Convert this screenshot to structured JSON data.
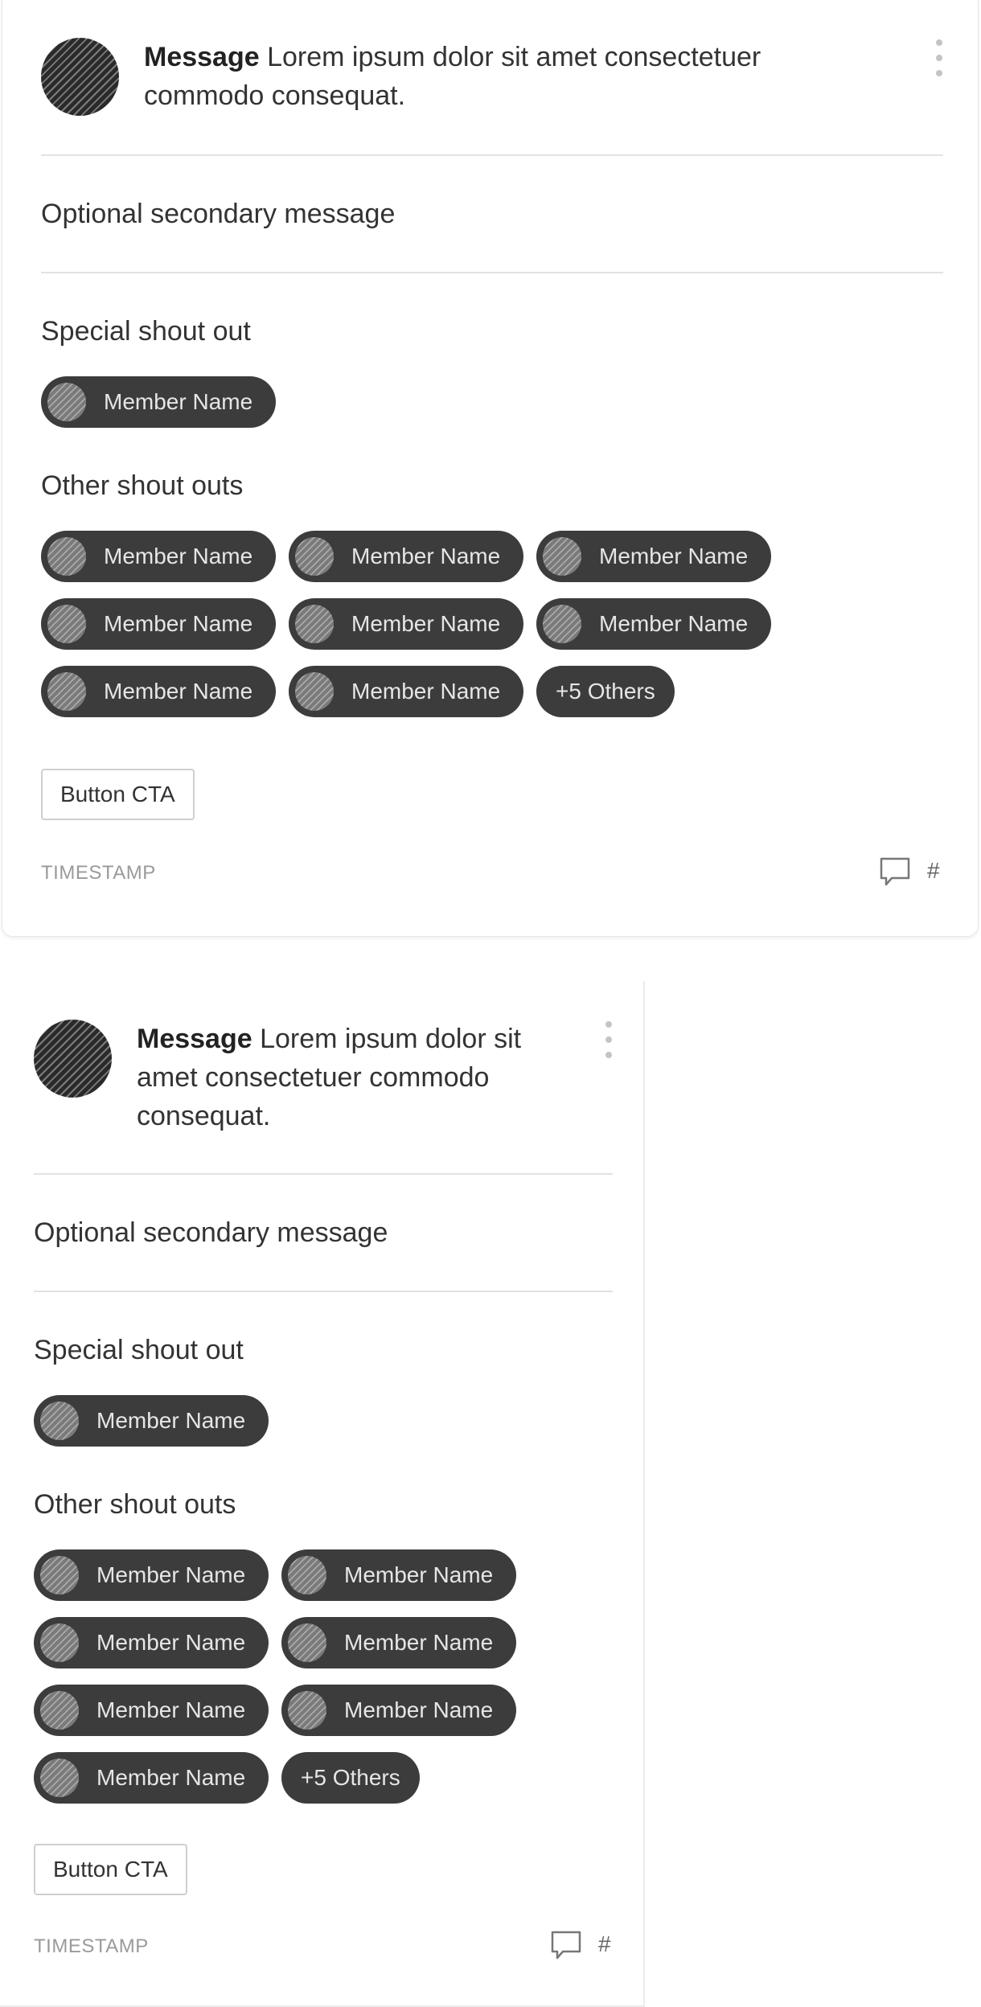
{
  "cards": [
    {
      "message_bold": "Message",
      "message_text": "Lorem ipsum dolor sit amet consectetuer commodo consequat.",
      "secondary": "Optional secondary message",
      "special_label": "Special shout out",
      "special_member": "Member Name",
      "other_label": "Other shout outs",
      "others": [
        "Member Name",
        "Member Name",
        "Member Name",
        "Member Name",
        "Member Name",
        "Member Name",
        "Member Name",
        "Member Name"
      ],
      "others_more": "+5 Others",
      "cta": "Button CTA",
      "timestamp": "TIMESTAMP",
      "hash": "#"
    },
    {
      "message_bold": "Message",
      "message_text": "Lorem ipsum dolor sit amet consectetuer commodo consequat.",
      "secondary": "Optional secondary message",
      "special_label": "Special shout out",
      "special_member": "Member Name",
      "other_label": "Other shout outs",
      "others": [
        "Member Name",
        "Member Name",
        "Member Name",
        "Member Name",
        "Member Name",
        "Member Name",
        "Member Name"
      ],
      "others_more": "+5 Others",
      "cta": "Button CTA",
      "timestamp": "TIMESTAMP",
      "hash": "#"
    }
  ],
  "icons": {
    "kebab": "more-vertical-icon",
    "comment": "comment-icon",
    "avatar": "avatar-placeholder"
  },
  "colors": {
    "chip_bg": "#3c3c3c",
    "chip_text": "#e6e6e6",
    "divider": "#e2e2e2",
    "timestamp": "#9a9a9a"
  }
}
